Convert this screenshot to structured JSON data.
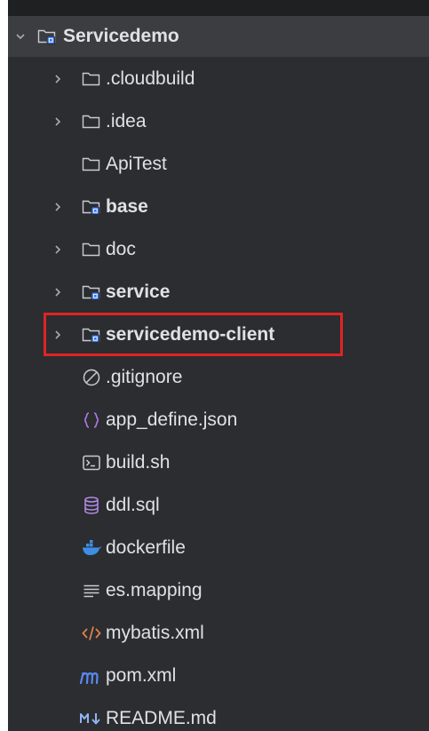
{
  "tree": {
    "root": {
      "label": "Servicedemo",
      "expanded": true,
      "icon": "module-folder-icon"
    },
    "items": [
      {
        "label": ".cloudbuild",
        "icon": "folder-icon",
        "expandable": true,
        "bold": false
      },
      {
        "label": ".idea",
        "icon": "folder-icon",
        "expandable": true,
        "bold": false
      },
      {
        "label": "ApiTest",
        "icon": "folder-icon",
        "expandable": false,
        "bold": false
      },
      {
        "label": "base",
        "icon": "module-folder-icon",
        "expandable": true,
        "bold": true
      },
      {
        "label": "doc",
        "icon": "folder-icon",
        "expandable": true,
        "bold": false
      },
      {
        "label": "service",
        "icon": "module-folder-icon",
        "expandable": true,
        "bold": true
      },
      {
        "label": "servicedemo-client",
        "icon": "module-folder-icon",
        "expandable": true,
        "bold": true,
        "highlighted": true
      },
      {
        "label": ".gitignore",
        "icon": "ignore-file-icon",
        "expandable": false,
        "bold": false
      },
      {
        "label": "app_define.json",
        "icon": "json-file-icon",
        "expandable": false,
        "bold": false
      },
      {
        "label": "build.sh",
        "icon": "shell-script-icon",
        "expandable": false,
        "bold": false
      },
      {
        "label": "ddl.sql",
        "icon": "database-sql-icon",
        "expandable": false,
        "bold": false
      },
      {
        "label": "dockerfile",
        "icon": "docker-icon",
        "expandable": false,
        "bold": false
      },
      {
        "label": "es.mapping",
        "icon": "text-file-icon",
        "expandable": false,
        "bold": false
      },
      {
        "label": "mybatis.xml",
        "icon": "xml-file-icon",
        "expandable": false,
        "bold": false
      },
      {
        "label": "pom.xml",
        "icon": "maven-pom-icon",
        "expandable": false,
        "bold": false
      },
      {
        "label": "README.md",
        "icon": "markdown-icon",
        "expandable": false,
        "bold": false
      }
    ]
  },
  "colors": {
    "background": "#2b2d30",
    "text": "#dfe1e5",
    "highlight_border": "#e02424",
    "module_badge": "#3574f0",
    "xml_icon": "#e8824a",
    "json_icon": "#b07ce8",
    "sql_icon": "#b48ce8",
    "docker_icon": "#3d8fe6",
    "maven_icon": "#5b88f0"
  }
}
